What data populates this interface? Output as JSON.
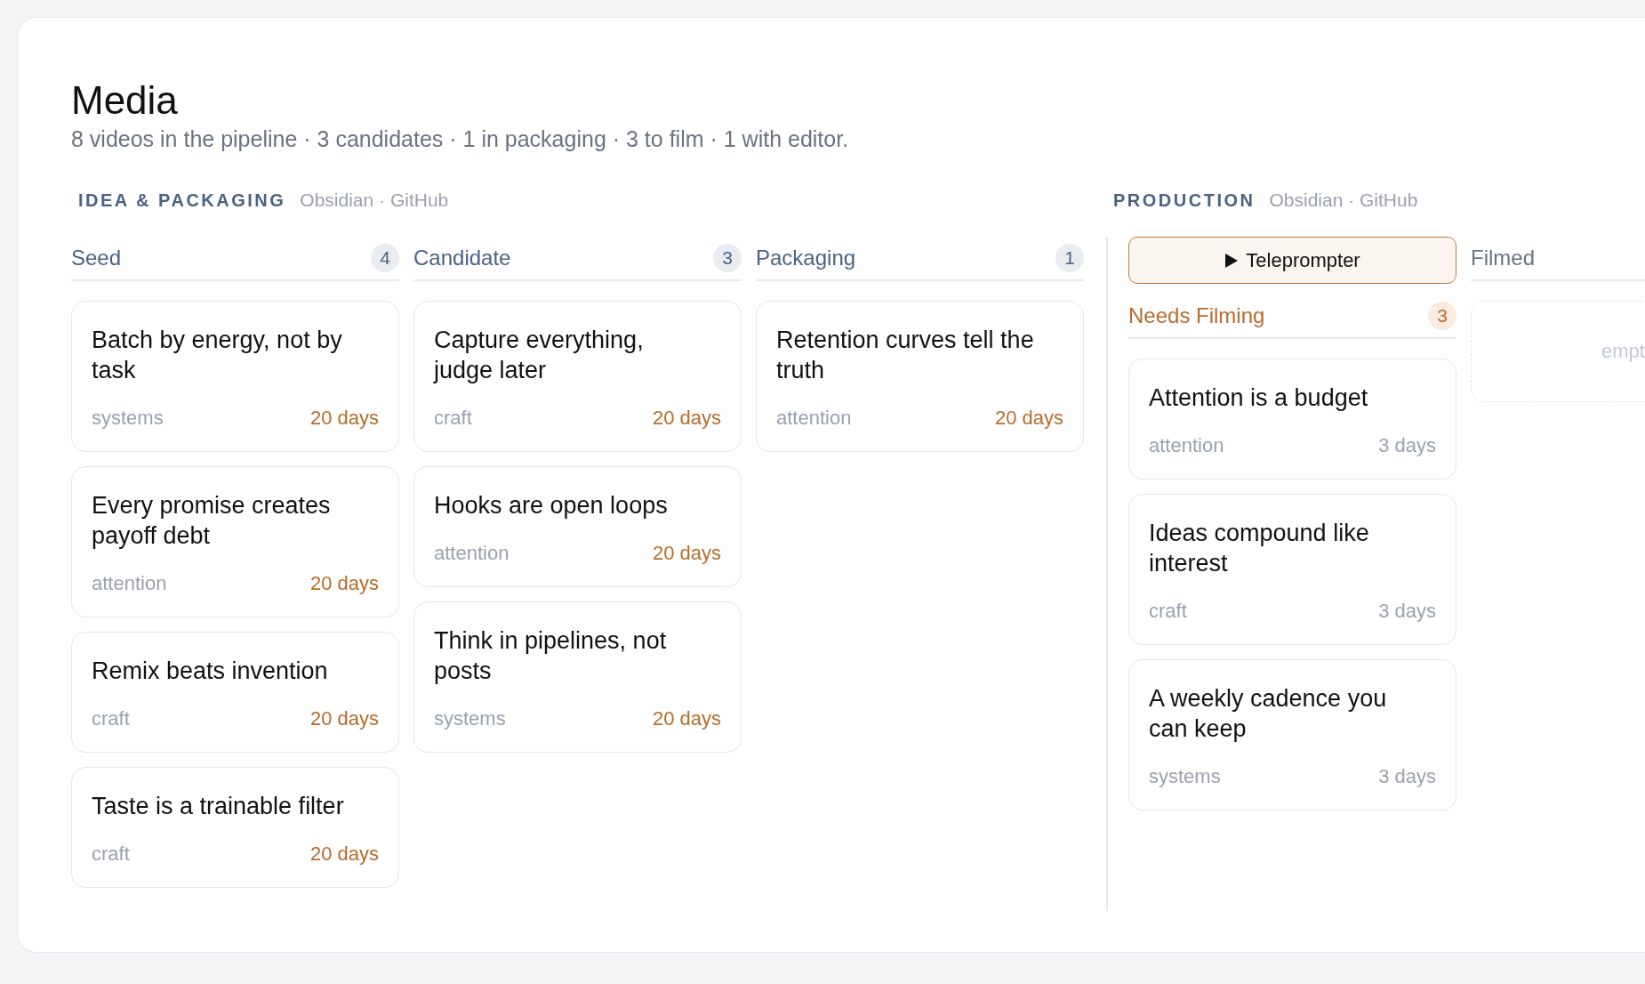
{
  "page": {
    "title": "Media",
    "summary": "8 videos in the pipeline · 3 candidates · 1 in packaging · 3 to film · 1 with editor."
  },
  "sections": [
    {
      "label": "IDEA & PACKAGING",
      "sources": "Obsidian · GitHub",
      "columns": [
        {
          "name": "Seed",
          "kind": "default",
          "count": "4",
          "cards": [
            {
              "title": "Batch by energy, not by task",
              "tag": "systems",
              "age": "20 days",
              "stale": true
            },
            {
              "title": "Every promise creates payoff debt",
              "tag": "attention",
              "age": "20 days",
              "stale": true
            },
            {
              "title": "Remix beats invention",
              "tag": "craft",
              "age": "20 days",
              "stale": true
            },
            {
              "title": "Taste is a trainable filter",
              "tag": "craft",
              "age": "20 days",
              "stale": true
            }
          ]
        },
        {
          "name": "Candidate",
          "kind": "default",
          "count": "3",
          "cards": [
            {
              "title": "Capture everything, judge later",
              "tag": "craft",
              "age": "20 days",
              "stale": true
            },
            {
              "title": "Hooks are open loops",
              "tag": "attention",
              "age": "20 days",
              "stale": true
            },
            {
              "title": "Think in pipelines, not posts",
              "tag": "systems",
              "age": "20 days",
              "stale": true
            }
          ]
        },
        {
          "name": "Packaging",
          "kind": "default",
          "count": "1",
          "cards": [
            {
              "title": "Retention curves tell the truth",
              "tag": "attention",
              "age": "20 days",
              "stale": true
            }
          ]
        }
      ]
    },
    {
      "label": "PRODUCTION",
      "sources": "Obsidian · GitHub",
      "columns": [
        {
          "name": "Needs Filming",
          "kind": "accent",
          "count": "3",
          "action": {
            "label": "Teleprompter"
          },
          "cards": [
            {
              "title": "Attention is a budget",
              "tag": "attention",
              "age": "3 days",
              "stale": false
            },
            {
              "title": "Ideas compound like interest",
              "tag": "craft",
              "age": "3 days",
              "stale": false
            },
            {
              "title": "A weekly cadence you can keep",
              "tag": "systems",
              "age": "3 days",
              "stale": false
            }
          ]
        },
        {
          "name": "Filmed",
          "kind": "muted",
          "empty": "empt"
        }
      ]
    }
  ]
}
